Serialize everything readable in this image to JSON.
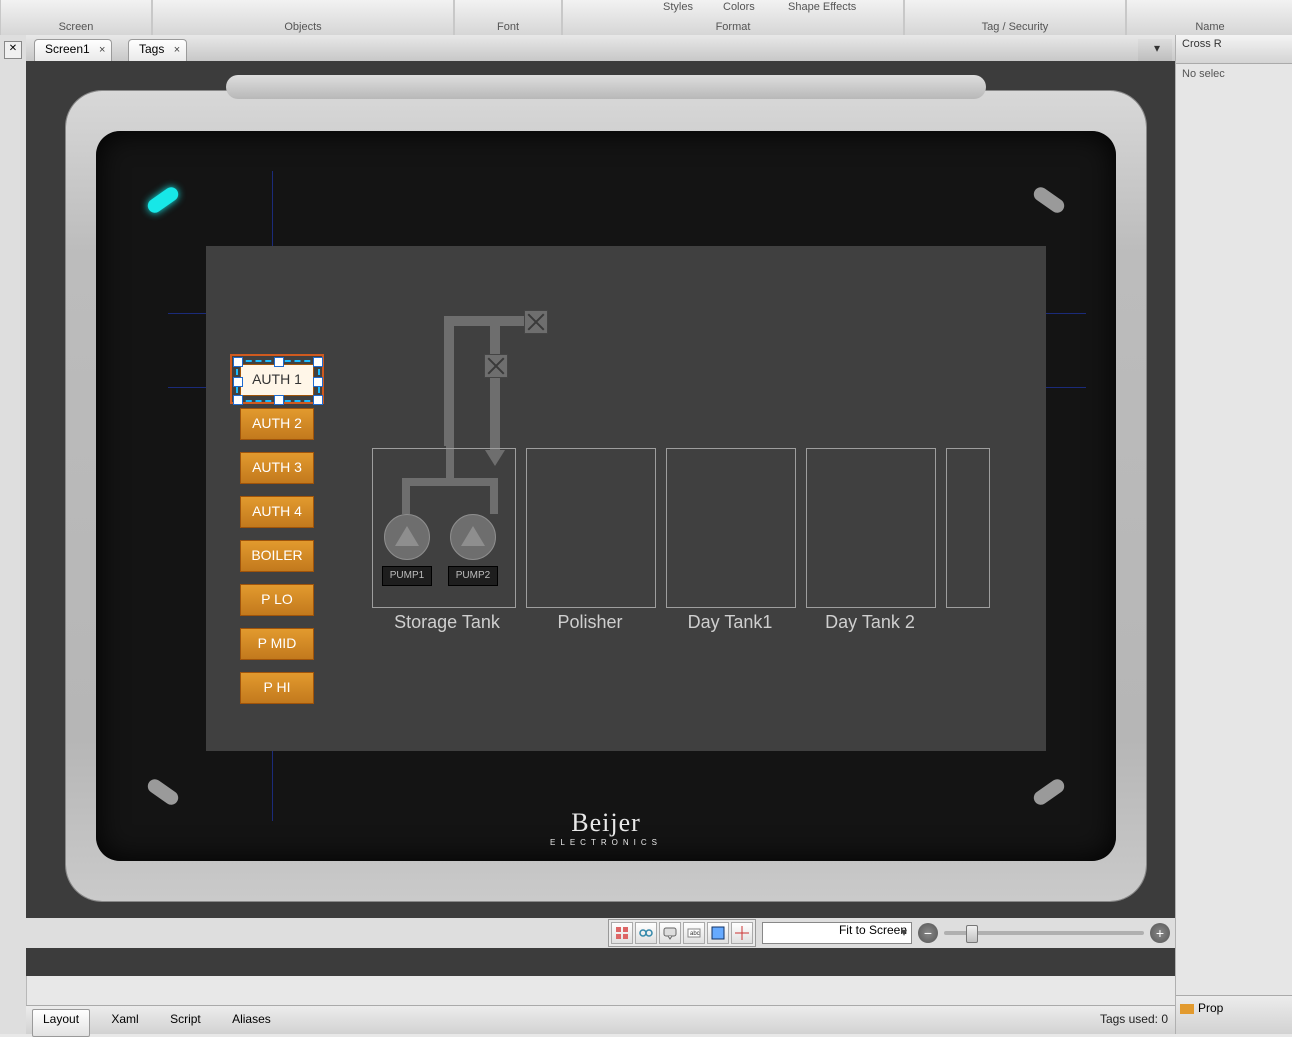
{
  "ribbon": {
    "groups": {
      "screen": "Screen",
      "objects": "Objects",
      "font": "Font",
      "format": "Format",
      "tag_security": "Tag / Security",
      "name": "Name"
    },
    "fragments": {
      "styles": "Styles",
      "colors": "Colors",
      "shape_effects": "Shape Effects"
    }
  },
  "tabs": [
    {
      "label": "Screen1"
    },
    {
      "label": "Tags"
    }
  ],
  "tab_overflow": "▾",
  "guides": {
    "h_top": "154,0",
    "h_mid": "766,0"
  },
  "nav_buttons": [
    {
      "label": "AUTH 1",
      "selected": true
    },
    {
      "label": "AUTH 2",
      "selected": false
    },
    {
      "label": "AUTH 3",
      "selected": false
    },
    {
      "label": "AUTH 4",
      "selected": false
    },
    {
      "label": "BOILER",
      "selected": false
    },
    {
      "label": "P LO",
      "selected": false
    },
    {
      "label": "P MID",
      "selected": false
    },
    {
      "label": "P HI",
      "selected": false
    }
  ],
  "tanks": [
    {
      "label": "Storage Tank"
    },
    {
      "label": "Polisher"
    },
    {
      "label": "Day Tank1"
    },
    {
      "label": "Day Tank 2"
    }
  ],
  "pumps": [
    {
      "label": "PUMP1"
    },
    {
      "label": "PUMP2"
    }
  ],
  "brand": {
    "name": "Beijer",
    "sub": "ELECTRONICS"
  },
  "zoom": {
    "combo": "Fit to Screen",
    "minus": "−",
    "plus": "+"
  },
  "bottom_tabs": [
    {
      "label": "Layout",
      "active": true
    },
    {
      "label": "Xaml",
      "active": false
    },
    {
      "label": "Script",
      "active": false
    },
    {
      "label": "Aliases",
      "active": false
    }
  ],
  "status": {
    "tags_used": "Tags used: 0"
  },
  "right_panel": {
    "header": "Cross R",
    "body": "No selec",
    "footer": "Prop"
  },
  "left_dock": {
    "close": "✕"
  }
}
